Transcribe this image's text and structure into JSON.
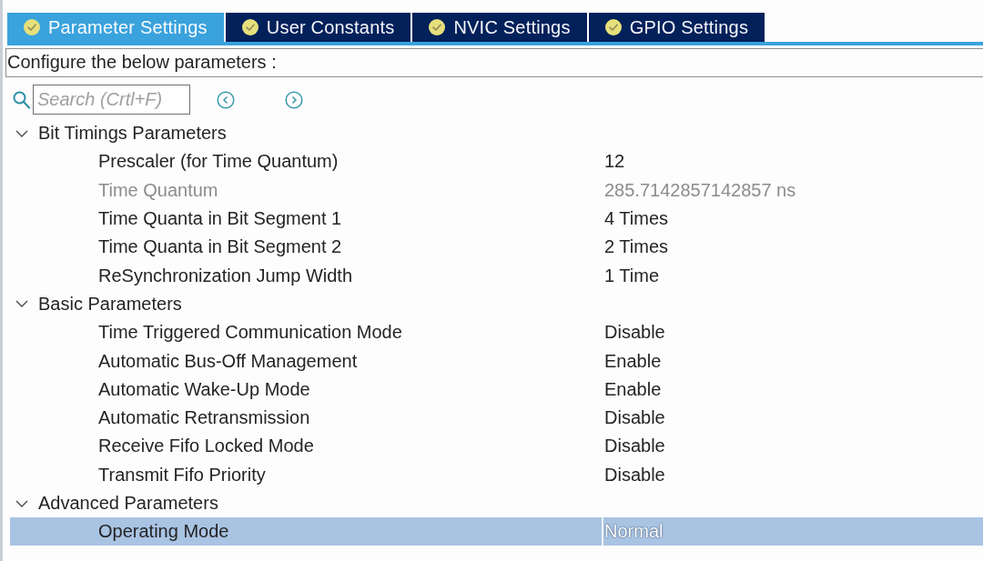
{
  "tabs": [
    {
      "label": "Parameter Settings",
      "selected": true
    },
    {
      "label": "User Constants",
      "selected": false
    },
    {
      "label": "NVIC Settings",
      "selected": false
    },
    {
      "label": "GPIO Settings",
      "selected": false
    }
  ],
  "description": "Configure the below parameters :",
  "search": {
    "placeholder": "Search (Crtl+F)"
  },
  "tree": [
    {
      "label": "Bit Timings Parameters",
      "expanded": true,
      "children": [
        {
          "label": "Prescaler (for Time Quantum)",
          "value": "12",
          "disabled": false,
          "selected": false
        },
        {
          "label": "Time Quantum",
          "value": "285.7142857142857 ns",
          "disabled": true,
          "selected": false
        },
        {
          "label": "Time Quanta in Bit Segment 1",
          "value": "4 Times",
          "disabled": false,
          "selected": false
        },
        {
          "label": "Time Quanta in Bit Segment 2",
          "value": "2 Times",
          "disabled": false,
          "selected": false
        },
        {
          "label": "ReSynchronization Jump Width",
          "value": "1 Time",
          "disabled": false,
          "selected": false
        }
      ]
    },
    {
      "label": "Basic Parameters",
      "expanded": true,
      "children": [
        {
          "label": "Time Triggered Communication Mode",
          "value": "Disable",
          "disabled": false,
          "selected": false
        },
        {
          "label": "Automatic Bus-Off Management",
          "value": "Enable",
          "disabled": false,
          "selected": false
        },
        {
          "label": "Automatic Wake-Up Mode",
          "value": "Enable",
          "disabled": false,
          "selected": false
        },
        {
          "label": "Automatic Retransmission",
          "value": "Disable",
          "disabled": false,
          "selected": false
        },
        {
          "label": "Receive Fifo Locked Mode",
          "value": "Disable",
          "disabled": false,
          "selected": false
        },
        {
          "label": "Transmit Fifo Priority",
          "value": "Disable",
          "disabled": false,
          "selected": false
        }
      ]
    },
    {
      "label": "Advanced Parameters",
      "expanded": true,
      "children": [
        {
          "label": "Operating Mode",
          "value": "Normal",
          "disabled": false,
          "selected": true
        }
      ]
    }
  ]
}
